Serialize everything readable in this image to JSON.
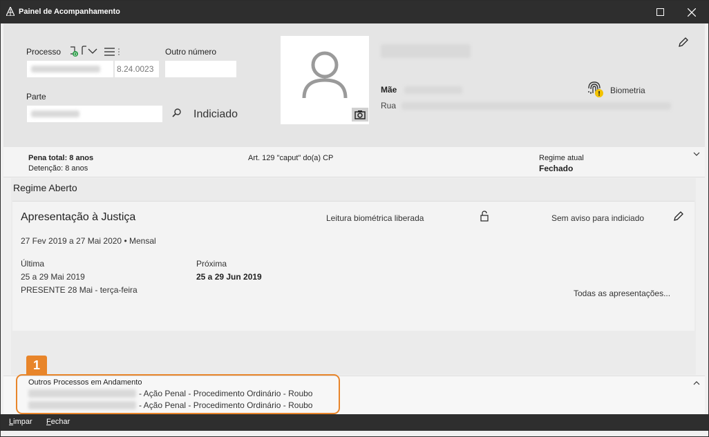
{
  "window": {
    "title": "Painel de Acompanhamento"
  },
  "header": {
    "processo_label": "Processo",
    "processo_value": "8.24.0023",
    "outro_numero_label": "Outro número",
    "parte_label": "Parte",
    "indiciado_label": "Indiciado",
    "mae_label": "Mãe",
    "rua_label": "Rua",
    "biometria_label": "Biometria"
  },
  "summary": {
    "pena_total": "Pena total: 8 anos",
    "detencao": "Detenção: 8 anos",
    "artigo": "Art. 129 \"caput\" do(a) CP",
    "regime_atual_label": "Regime atual",
    "regime_atual_value": "Fechado"
  },
  "regime": {
    "title": "Regime Aberto",
    "card": {
      "title": "Apresentação à Justiça",
      "leitura": "Leitura biométrica liberada",
      "aviso": "Sem aviso para indiciado",
      "periodo": "27 Fev 2019 a 27 Mai 2020 • Mensal",
      "ultima_label": "Última",
      "ultima_value": "25 a 29 Mai 2019",
      "ultima_presente": "PRESENTE 28 Mai - terça-feira",
      "proxima_label": "Próxima",
      "proxima_value": "25 a 29 Jun 2019",
      "todas_link": "Todas as apresentações..."
    }
  },
  "outros": {
    "title": "Outros Processos em Andamento",
    "items": [
      {
        "desc": "- Ação Penal - Procedimento Ordinário - Roubo"
      },
      {
        "desc": "- Ação Penal - Procedimento Ordinário - Roubo"
      }
    ]
  },
  "annotation": {
    "badge": "1",
    "color": "#e8852a"
  },
  "footer": {
    "limpar_u": "L",
    "limpar_rest": "impar",
    "fechar_u": "F",
    "fechar_rest": "echar"
  }
}
